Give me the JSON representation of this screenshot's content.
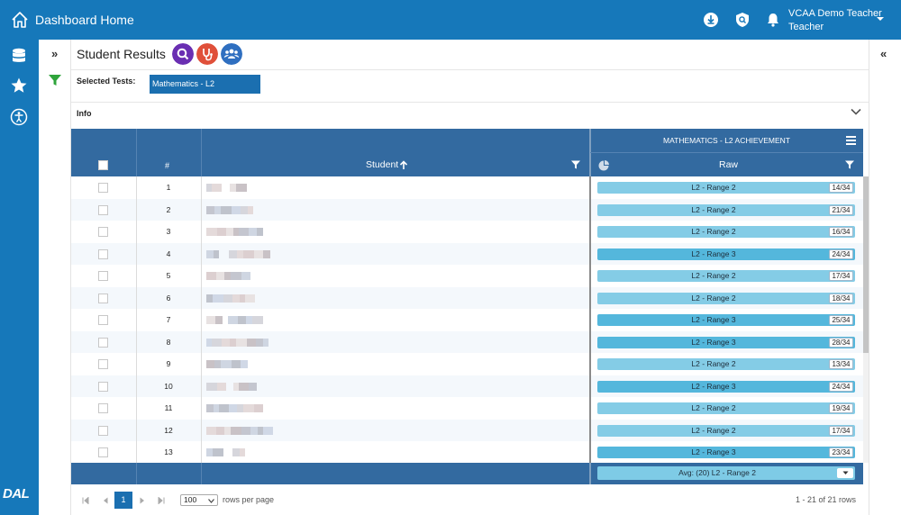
{
  "header": {
    "title": "Dashboard Home",
    "user_name": "VCAA Demo Teacher",
    "user_role": "Teacher",
    "icons": [
      "home-icon",
      "download-icon",
      "shield-search-icon",
      "bell-icon",
      "caret-down-icon"
    ]
  },
  "sidebar": {
    "icons": [
      "database-icon",
      "star-icon",
      "accessibility-icon"
    ],
    "brand": "DAL"
  },
  "subbar": {
    "expand": "»",
    "collapse": "«"
  },
  "page": {
    "title": "Student Results",
    "action_colors": [
      "#6a2fb2",
      "#e0503a",
      "#2f6fc0"
    ]
  },
  "selected_tests": {
    "label": "Selected Tests:",
    "chips": [
      "Mathematics - L2 Achievement"
    ]
  },
  "info": {
    "label": "Info"
  },
  "table": {
    "test_header": "MATHEMATICS - L2 ACHIEVEMENT",
    "col_hash": "#",
    "col_student": "Student",
    "col_raw": "Raw",
    "range_colors": {
      "L2 - Range 2": "#84cce6",
      "L2 - Range 3": "#54b7dc"
    },
    "rows": [
      {
        "num": "1",
        "range": "L2 - Range 2",
        "score": "14/34"
      },
      {
        "num": "2",
        "range": "L2 - Range 2",
        "score": "21/34"
      },
      {
        "num": "3",
        "range": "L2 - Range 2",
        "score": "16/34"
      },
      {
        "num": "4",
        "range": "L2 - Range 3",
        "score": "24/34"
      },
      {
        "num": "5",
        "range": "L2 - Range 2",
        "score": "17/34"
      },
      {
        "num": "6",
        "range": "L2 - Range 2",
        "score": "18/34"
      },
      {
        "num": "7",
        "range": "L2 - Range 3",
        "score": "25/34"
      },
      {
        "num": "8",
        "range": "L2 - Range 3",
        "score": "28/34"
      },
      {
        "num": "9",
        "range": "L2 - Range 2",
        "score": "13/34"
      },
      {
        "num": "10",
        "range": "L2 - Range 3",
        "score": "24/34"
      },
      {
        "num": "11",
        "range": "L2 - Range 2",
        "score": "19/34"
      },
      {
        "num": "12",
        "range": "L2 - Range 2",
        "score": "17/34"
      },
      {
        "num": "13",
        "range": "L2 - Range 3",
        "score": "23/34"
      }
    ],
    "average": "Avg: (20) L2 - Range 2"
  },
  "pagination": {
    "current_page": "1",
    "per_page": "100",
    "per_page_label": "rows per page",
    "range_text": "1 - 21 of 21 rows"
  }
}
